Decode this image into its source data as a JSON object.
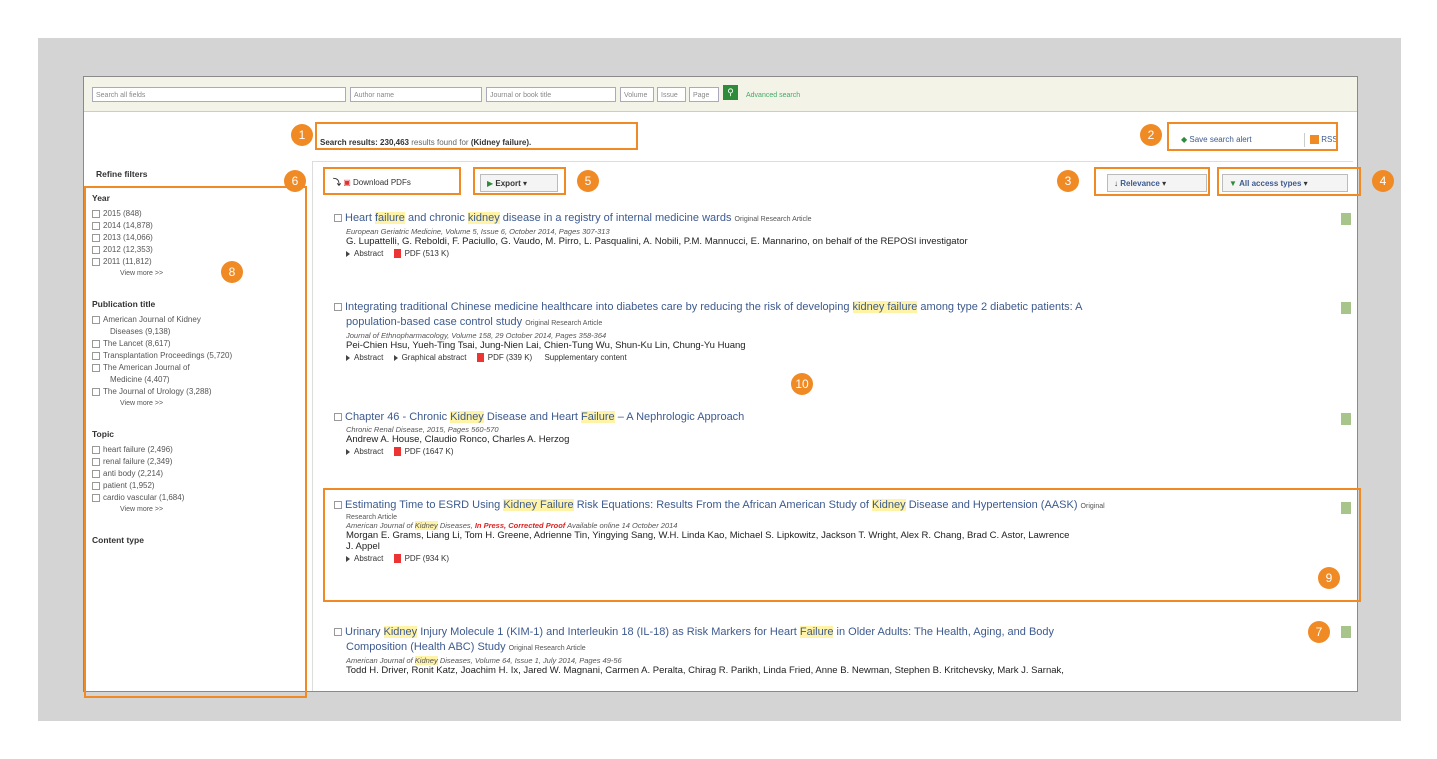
{
  "search": {
    "fields": [
      "Search all fields",
      "Author name",
      "Journal or book title",
      "Volume",
      "Issue",
      "Page"
    ],
    "advanced": "Advanced search"
  },
  "summary": {
    "label": "Search results:",
    "count": "230,463",
    "text": "results found for",
    "query": "(Kidney failure)."
  },
  "top_right": {
    "save": "Save search alert",
    "rss": "RSS"
  },
  "toolbar": {
    "download": "Download PDFs",
    "export": "Export",
    "relevance": "Relevance",
    "access": "All access types"
  },
  "sidebar": {
    "title": "Refine filters",
    "groups": [
      {
        "heading": "Year",
        "items": [
          "2015 (848)",
          "2014 (14,878)",
          "2013 (14,066)",
          "2012 (12,353)",
          "2011 (11,812)"
        ],
        "more": "View more >>"
      },
      {
        "heading": "Publication title",
        "items": [
          "American Journal of Kidney",
          "Diseases (9,138)",
          "The Lancet (8,617)",
          "Transplantation Proceedings (5,720)",
          "The American Journal of",
          "Medicine (4,407)",
          "The Journal of Urology (3,288)"
        ],
        "more": "View more >>"
      },
      {
        "heading": "Topic",
        "items": [
          "heart failure (2,496)",
          "renal failure (2,349)",
          "anti body (2,214)",
          "patient (1,952)",
          "cardio vascular (1,684)"
        ],
        "more": "View more >>"
      }
    ],
    "last_heading": "Content type"
  },
  "results": [
    {
      "title": [
        "Heart ",
        "failure",
        " and chronic ",
        "kidney",
        " disease in a registry of internal medicine wards"
      ],
      "type": "Original Research Article",
      "meta": "European Geriatric Medicine, Volume 5, Issue 6, October 2014, Pages 307-313",
      "authors": "G. Lupattelli, G. Reboldi, F. Paciullo, G. Vaudo, M. Pirro, L. Pasqualini, A. Nobili, P.M. Mannucci, E. Mannarino, on behalf of the REPOSI investigator",
      "abstract": "Abstract",
      "pdf": "PDF (513 K)"
    },
    {
      "title": [
        "Integrating traditional Chinese medicine healthcare into diabetes care by reducing the risk of developing ",
        "kidney failure",
        " among type 2 diabetic patients: A"
      ],
      "title2": "population-based case control study",
      "type": "Original Research Article",
      "meta": "Journal of Ethnopharmacology, Volume 158, 29 October 2014, Pages 358-364",
      "authors": "Pei-Chien Hsu, Yueh-Ting Tsai, Jung-Nien Lai, Chien-Tung Wu, Shun-Ku Lin, Chung-Yu Huang",
      "abstract": "Abstract",
      "graphical": "Graphical abstract",
      "pdf": "PDF (339 K)",
      "supp": "Supplementary content"
    },
    {
      "title": [
        "Chapter 46 - Chronic ",
        "Kidney",
        " Disease and Heart ",
        "Failure",
        " – A Nephrologic Approach"
      ],
      "meta": "Chronic Renal Disease, 2015, Pages 560-570",
      "authors": "Andrew A. House, Claudio Ronco, Charles A. Herzog",
      "abstract": "Abstract",
      "pdf": "PDF (1647 K)"
    },
    {
      "title": [
        "Estimating Time to ESRD Using ",
        "Kidney Failure",
        " Risk Equations: Results From the African American Study of ",
        "Kidney",
        " Disease and Hypertension (AASK)"
      ],
      "type": "Original",
      "type2": "Research Article",
      "meta_a": "American Journal of ",
      "meta_hl": "Kidney",
      "meta_b": " Diseases, ",
      "press": "In Press, Corrected Proof",
      "meta_c": " Available online 14 October 2014",
      "authors": "Morgan E. Grams, Liang Li, Tom H. Greene, Adrienne Tin, Yingying Sang, W.H. Linda Kao, Michael S. Lipkowitz, Jackson T. Wright, Alex R. Chang, Brad C. Astor, Lawrence",
      "authors2": "J. Appel",
      "abstract": "Abstract",
      "pdf": "PDF (934 K)"
    },
    {
      "title": [
        "Urinary ",
        "Kidney",
        " Injury Molecule 1 (KIM-1) and Interleukin 18 (IL-18) as Risk Markers for Heart ",
        "Failure",
        " in Older Adults: The Health, Aging, and Body"
      ],
      "title2": "Composition (Health ABC) Study",
      "type": "Original Research Article",
      "meta_a": "American Journal of ",
      "meta_hl": "Kidney",
      "meta_b": " Diseases, Volume 64, Issue 1, July 2014, Pages 49-56",
      "authors": "Todd H. Driver, Ronit Katz, Joachim H. Ix, Jared W. Magnani, Carmen A. Peralta, Chirag R. Parikh, Linda Fried, Anne B. Newman, Stephen B. Kritchevsky, Mark J. Sarnak,"
    }
  ],
  "callouts": [
    "1",
    "2",
    "3",
    "4",
    "5",
    "6",
    "7",
    "8",
    "9",
    "10"
  ],
  "colors": {
    "callout": "#f08a24",
    "link": "#3d5a8f",
    "highlight": "#fff3a8"
  }
}
